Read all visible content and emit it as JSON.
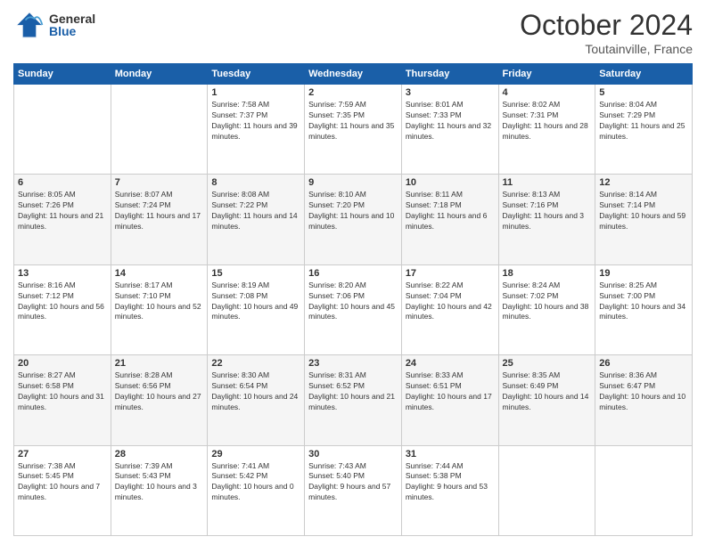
{
  "header": {
    "month": "October 2024",
    "location": "Toutainville, France",
    "logo_general": "General",
    "logo_blue": "Blue"
  },
  "days_of_week": [
    "Sunday",
    "Monday",
    "Tuesday",
    "Wednesday",
    "Thursday",
    "Friday",
    "Saturday"
  ],
  "weeks": [
    [
      {
        "num": "",
        "info": ""
      },
      {
        "num": "",
        "info": ""
      },
      {
        "num": "1",
        "info": "Sunrise: 7:58 AM\nSunset: 7:37 PM\nDaylight: 11 hours and 39 minutes."
      },
      {
        "num": "2",
        "info": "Sunrise: 7:59 AM\nSunset: 7:35 PM\nDaylight: 11 hours and 35 minutes."
      },
      {
        "num": "3",
        "info": "Sunrise: 8:01 AM\nSunset: 7:33 PM\nDaylight: 11 hours and 32 minutes."
      },
      {
        "num": "4",
        "info": "Sunrise: 8:02 AM\nSunset: 7:31 PM\nDaylight: 11 hours and 28 minutes."
      },
      {
        "num": "5",
        "info": "Sunrise: 8:04 AM\nSunset: 7:29 PM\nDaylight: 11 hours and 25 minutes."
      }
    ],
    [
      {
        "num": "6",
        "info": "Sunrise: 8:05 AM\nSunset: 7:26 PM\nDaylight: 11 hours and 21 minutes."
      },
      {
        "num": "7",
        "info": "Sunrise: 8:07 AM\nSunset: 7:24 PM\nDaylight: 11 hours and 17 minutes."
      },
      {
        "num": "8",
        "info": "Sunrise: 8:08 AM\nSunset: 7:22 PM\nDaylight: 11 hours and 14 minutes."
      },
      {
        "num": "9",
        "info": "Sunrise: 8:10 AM\nSunset: 7:20 PM\nDaylight: 11 hours and 10 minutes."
      },
      {
        "num": "10",
        "info": "Sunrise: 8:11 AM\nSunset: 7:18 PM\nDaylight: 11 hours and 6 minutes."
      },
      {
        "num": "11",
        "info": "Sunrise: 8:13 AM\nSunset: 7:16 PM\nDaylight: 11 hours and 3 minutes."
      },
      {
        "num": "12",
        "info": "Sunrise: 8:14 AM\nSunset: 7:14 PM\nDaylight: 10 hours and 59 minutes."
      }
    ],
    [
      {
        "num": "13",
        "info": "Sunrise: 8:16 AM\nSunset: 7:12 PM\nDaylight: 10 hours and 56 minutes."
      },
      {
        "num": "14",
        "info": "Sunrise: 8:17 AM\nSunset: 7:10 PM\nDaylight: 10 hours and 52 minutes."
      },
      {
        "num": "15",
        "info": "Sunrise: 8:19 AM\nSunset: 7:08 PM\nDaylight: 10 hours and 49 minutes."
      },
      {
        "num": "16",
        "info": "Sunrise: 8:20 AM\nSunset: 7:06 PM\nDaylight: 10 hours and 45 minutes."
      },
      {
        "num": "17",
        "info": "Sunrise: 8:22 AM\nSunset: 7:04 PM\nDaylight: 10 hours and 42 minutes."
      },
      {
        "num": "18",
        "info": "Sunrise: 8:24 AM\nSunset: 7:02 PM\nDaylight: 10 hours and 38 minutes."
      },
      {
        "num": "19",
        "info": "Sunrise: 8:25 AM\nSunset: 7:00 PM\nDaylight: 10 hours and 34 minutes."
      }
    ],
    [
      {
        "num": "20",
        "info": "Sunrise: 8:27 AM\nSunset: 6:58 PM\nDaylight: 10 hours and 31 minutes."
      },
      {
        "num": "21",
        "info": "Sunrise: 8:28 AM\nSunset: 6:56 PM\nDaylight: 10 hours and 27 minutes."
      },
      {
        "num": "22",
        "info": "Sunrise: 8:30 AM\nSunset: 6:54 PM\nDaylight: 10 hours and 24 minutes."
      },
      {
        "num": "23",
        "info": "Sunrise: 8:31 AM\nSunset: 6:52 PM\nDaylight: 10 hours and 21 minutes."
      },
      {
        "num": "24",
        "info": "Sunrise: 8:33 AM\nSunset: 6:51 PM\nDaylight: 10 hours and 17 minutes."
      },
      {
        "num": "25",
        "info": "Sunrise: 8:35 AM\nSunset: 6:49 PM\nDaylight: 10 hours and 14 minutes."
      },
      {
        "num": "26",
        "info": "Sunrise: 8:36 AM\nSunset: 6:47 PM\nDaylight: 10 hours and 10 minutes."
      }
    ],
    [
      {
        "num": "27",
        "info": "Sunrise: 7:38 AM\nSunset: 5:45 PM\nDaylight: 10 hours and 7 minutes."
      },
      {
        "num": "28",
        "info": "Sunrise: 7:39 AM\nSunset: 5:43 PM\nDaylight: 10 hours and 3 minutes."
      },
      {
        "num": "29",
        "info": "Sunrise: 7:41 AM\nSunset: 5:42 PM\nDaylight: 10 hours and 0 minutes."
      },
      {
        "num": "30",
        "info": "Sunrise: 7:43 AM\nSunset: 5:40 PM\nDaylight: 9 hours and 57 minutes."
      },
      {
        "num": "31",
        "info": "Sunrise: 7:44 AM\nSunset: 5:38 PM\nDaylight: 9 hours and 53 minutes."
      },
      {
        "num": "",
        "info": ""
      },
      {
        "num": "",
        "info": ""
      }
    ]
  ]
}
